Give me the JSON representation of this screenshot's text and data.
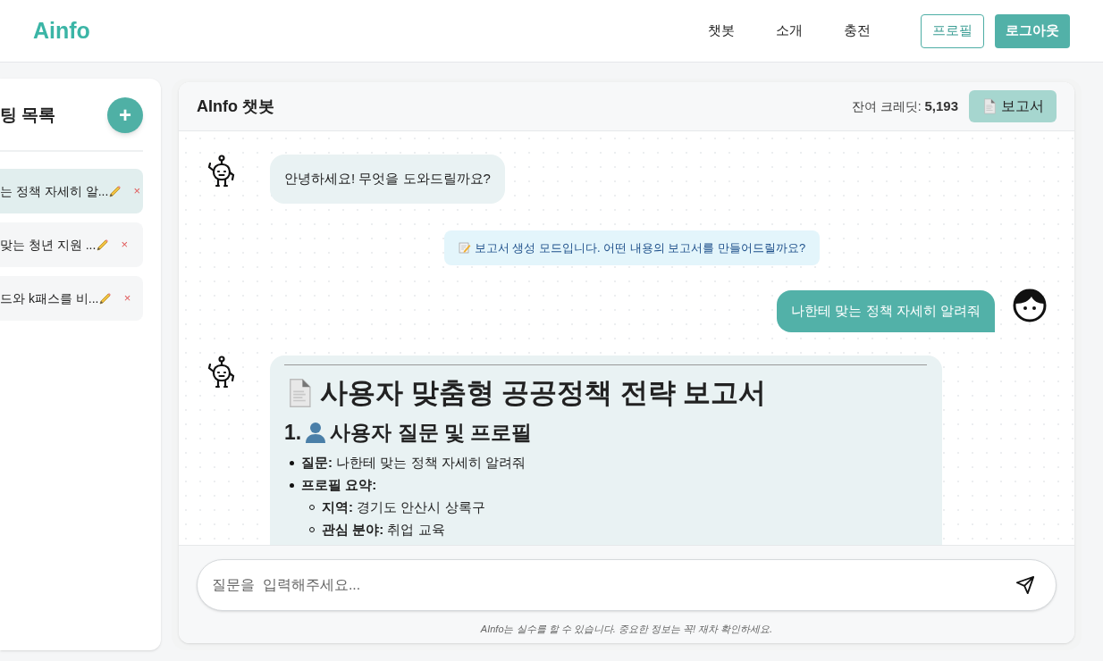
{
  "header": {
    "logo": "Ainfo",
    "nav": [
      "챗봇",
      "소개",
      "충전"
    ],
    "profile_button": "프로필",
    "logout_button": "로그아웃"
  },
  "sidebar": {
    "title": "팅 목록",
    "add_button": "+",
    "items": [
      {
        "title": "는 정책 자세히 알...",
        "selected": true,
        "delete": "×"
      },
      {
        "title": "맞는 청년 지원 ...",
        "selected": false,
        "delete": "×"
      },
      {
        "title": "드와 k패스를 비...",
        "selected": false,
        "delete": "×"
      }
    ]
  },
  "chat": {
    "title": "AInfo 챗봇",
    "credits_label": "잔여 크레딧:",
    "credits_value": "5,193",
    "report_button": "보고서",
    "messages": [
      {
        "kind": "bot",
        "text": "안녕하세요! 무엇을 도와드릴까요?"
      },
      {
        "kind": "notice",
        "text": "보고서 생성 모드입니다. 어떤 내용의 보고서를 만들어드릴까요?"
      },
      {
        "kind": "user",
        "text": "나한테 맞는 정책 자세히 알려줘"
      },
      {
        "kind": "report",
        "title": "사용자 맞춤형 공공정책 전략 보고서",
        "section_number": "1.",
        "section_title": "사용자 질문 및 프로필",
        "items": [
          {
            "text": "**질문:** 나한테 맞는 정책 자세히 알려줘"
          },
          {
            "text": "**프로필 요약:**",
            "children": [
              {
                "text": "**지역:** 경기도 안산시 상록구"
              },
              {
                "text": "**관심 분야:** 취업 교육"
              }
            ]
          }
        ]
      }
    ],
    "input": {
      "placeholder": "질문을  입력해주세요..."
    },
    "disclaimer": "AInfo는 실수를 할 수 있습니다. 중요한 정보는 꼭! 재차 확인하세요."
  }
}
